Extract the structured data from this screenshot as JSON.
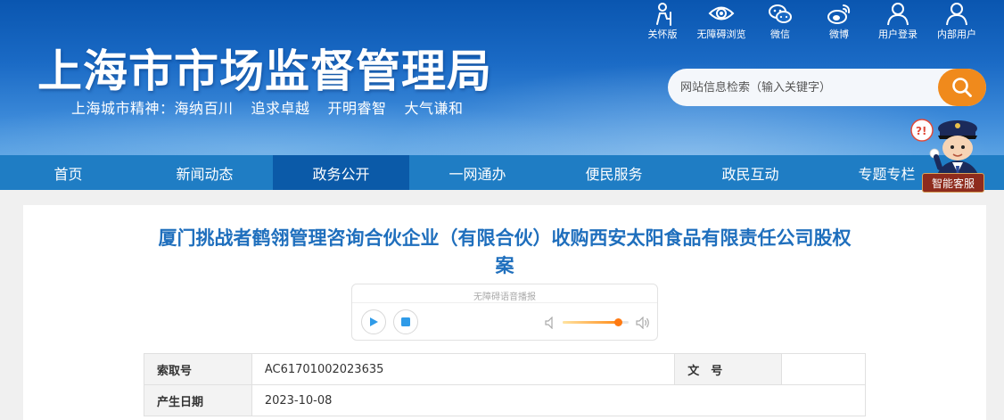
{
  "header": {
    "site_title": "上海市市场监督管理局",
    "slogan": [
      "上海城市精神：海纳百川",
      "追求卓越",
      "开明睿智",
      "大气谦和"
    ]
  },
  "toolbar": [
    {
      "label": "关怀版",
      "icon": "elderly-care-icon"
    },
    {
      "label": "无障碍浏览",
      "icon": "eye-icon"
    },
    {
      "label": "微信",
      "icon": "wechat-icon"
    },
    {
      "label": "微博",
      "icon": "weibo-icon"
    },
    {
      "label": "用户登录",
      "icon": "user-icon"
    },
    {
      "label": "内部用户",
      "icon": "user-icon"
    }
  ],
  "search": {
    "placeholder": "网站信息检索（输入关键字）",
    "icon": "search-icon"
  },
  "nav": {
    "items": [
      "首页",
      "新闻动态",
      "政务公开",
      "一网通办",
      "便民服务",
      "政民互动",
      "专题专栏"
    ],
    "active": "政务公开"
  },
  "assistant": {
    "label": "智能客服"
  },
  "article": {
    "title_line1": "厦门挑战者鹤翎管理咨询合伙企业（有限合伙）收购西安太阳食品有限责任公司股权",
    "title_line2": "案"
  },
  "audio_player": {
    "caption": "无障碍语音播报",
    "volume": 0.85
  },
  "info": {
    "index_label": "索取号",
    "index_value": "AC61701002023635",
    "doc_no_label": "文　号",
    "doc_no_value": "",
    "date_label": "产生日期",
    "date_value": "2023-10-08"
  },
  "colors": {
    "header_blue": "#1a6ac5",
    "nav_blue": "#1f7dc4",
    "nav_active": "#0b5aa8",
    "title_blue": "#1f6fbd",
    "search_orange": "#f08a1c"
  }
}
